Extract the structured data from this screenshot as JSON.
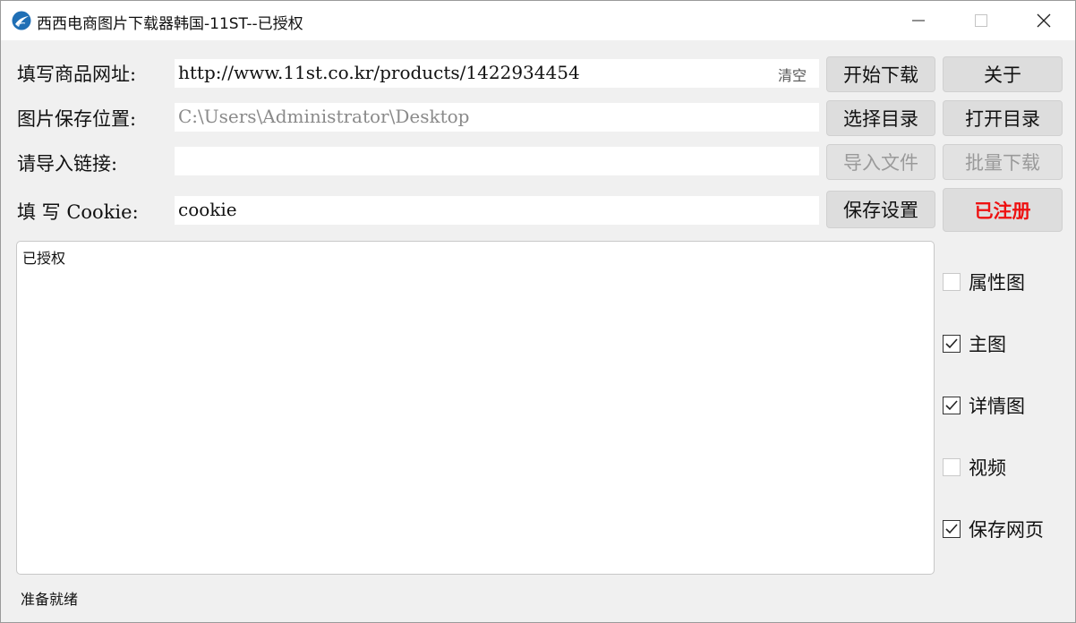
{
  "window": {
    "title": "西西电商图片下载器韩国-11ST--已授权"
  },
  "form": {
    "url_label": "填写商品网址:",
    "url_value": "http://www.11st.co.kr/products/1422934454",
    "clear_label": "清空",
    "save_path_label": "图片保存位置:",
    "save_path_value": "C:\\Users\\Administrator\\Desktop",
    "import_label": "请导入链接:",
    "import_value": "",
    "cookie_label": "填 写 Cookie:",
    "cookie_value": "cookie"
  },
  "buttons": {
    "start_download": "开始下载",
    "about": "关于",
    "choose_dir": "选择目录",
    "open_dir": "打开目录",
    "import_file": "导入文件",
    "batch_download": "批量下载",
    "save_settings": "保存设置",
    "registered": "已注册"
  },
  "log": {
    "text": "已授权"
  },
  "options": [
    {
      "label": "属性图",
      "checked": false
    },
    {
      "label": "主图",
      "checked": true
    },
    {
      "label": "详情图",
      "checked": true
    },
    {
      "label": "视频",
      "checked": false
    },
    {
      "label": "保存网页",
      "checked": true
    }
  ],
  "status": {
    "text": "准备就绪"
  },
  "colors": {
    "registered": "#ee1111",
    "window_bg": "#f0f0f0"
  }
}
